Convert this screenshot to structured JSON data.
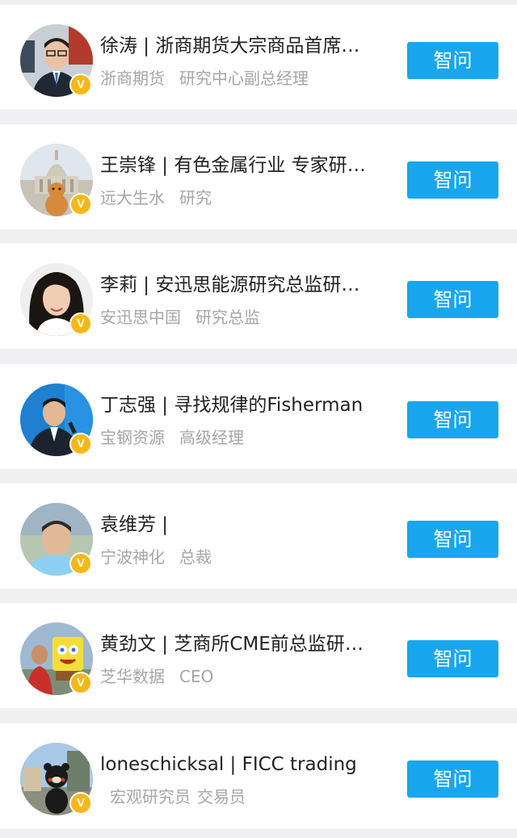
{
  "experts": [
    {
      "name": "徐涛 | 浙商期货大宗商品首席研究员",
      "org": "浙商期货",
      "title": "研究中心副总经理",
      "button": "智问",
      "badge": "V"
    },
    {
      "name": "王崇锋 | 有色金属行业 专家研究员",
      "org": "远大生水",
      "title": "研究",
      "button": "智问",
      "badge": "V"
    },
    {
      "name": "李莉 | 安迅思能源研究总监研究员",
      "org": "安迅思中国",
      "title": "研究总监",
      "button": "智问",
      "badge": "V"
    },
    {
      "name": "丁志强 | 寻找规律的Fisherman",
      "org": "宝钢资源",
      "title": "高级经理",
      "button": "智问",
      "badge": "V"
    },
    {
      "name": "袁维芳 |",
      "org": "宁波神化",
      "title": "总裁",
      "button": "智问",
      "badge": "V"
    },
    {
      "name": "黄劲文 | 芝商所CME前总监研究员",
      "org": "芝华数据",
      "title": "CEO",
      "button": "智问",
      "badge": "V"
    },
    {
      "name": "loneschicksal | FICC trading",
      "org": "宏观研究员",
      "title": "交易员",
      "button": "智问",
      "badge": "V"
    }
  ]
}
